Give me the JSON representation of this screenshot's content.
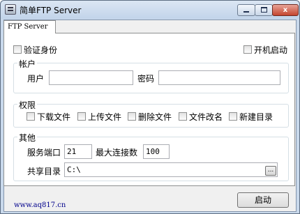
{
  "window": {
    "title": "简单FTP Server",
    "controls": {
      "minimize": "minimize",
      "maximize": "maximize",
      "close": "x"
    }
  },
  "tabs": [
    {
      "label": "FTP Server",
      "selected": true
    }
  ],
  "auth": {
    "verify_label": "验证身份",
    "verify_checked": false,
    "autostart_label": "开机启动",
    "autostart_checked": false
  },
  "account": {
    "legend": "帐户",
    "user_label": "用户",
    "user_value": "",
    "password_label": "密码",
    "password_value": ""
  },
  "permissions": {
    "legend": "权限",
    "items": [
      {
        "label": "下载文件",
        "checked": false
      },
      {
        "label": "上传文件",
        "checked": false
      },
      {
        "label": "删除文件",
        "checked": false
      },
      {
        "label": "文件改名",
        "checked": false
      },
      {
        "label": "新建目录",
        "checked": false
      }
    ]
  },
  "other": {
    "legend": "其他",
    "port_label": "服务端口",
    "port_value": "21",
    "maxconn_label": "最大连接数",
    "maxconn_value": "100",
    "share_label": "共享目录",
    "share_value": "C:\\",
    "browse_label": "..."
  },
  "footer": {
    "link_text": "www.aq817.cn",
    "start_label": "启动"
  }
}
